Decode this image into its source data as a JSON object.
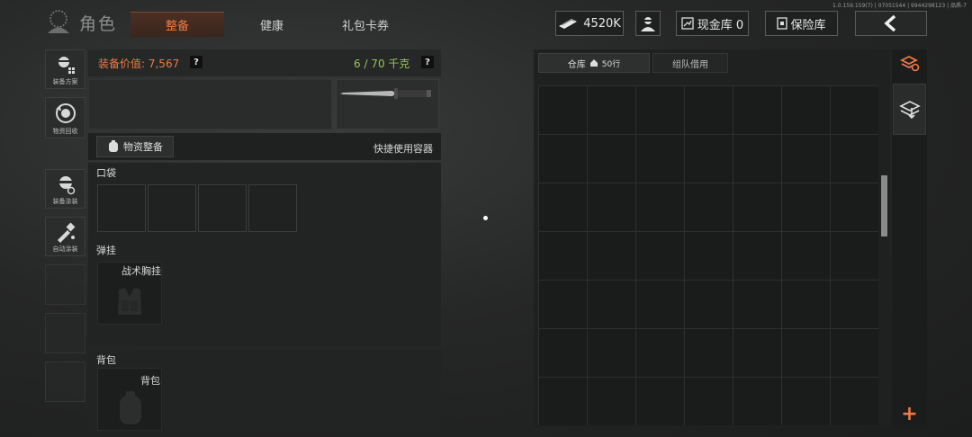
{
  "version": "1.0.159.159(7) | 07051544 | 9944298123 | 品质-7",
  "header": {
    "title": "角色",
    "tabs": [
      {
        "label": "整备",
        "active": true
      },
      {
        "label": "健康",
        "active": false
      },
      {
        "label": "礼包卡券",
        "active": false
      }
    ],
    "money": "4520K",
    "cashbox": "现金库 0",
    "safebox": "保险库"
  },
  "left_menu": [
    {
      "label": "装备方案",
      "icon": "loadout-plan-icon"
    },
    {
      "label": "物资回收",
      "icon": "recycle-icon"
    },
    {
      "label": "装备涂装",
      "icon": "gear-paint-icon"
    },
    {
      "label": "自动涂装",
      "icon": "auto-paint-icon"
    }
  ],
  "loadout": {
    "value_label": "装备价值: 7,567",
    "weight_label": "6 / 70 千克",
    "help": "?",
    "supply_button": "物资整备",
    "quick_container": "快捷使用容器",
    "pocket_title": "口袋",
    "rig_title": "弹挂",
    "rig_slot": "战术胸挂",
    "backpack_title": "背包",
    "backpack_slot": "背包"
  },
  "warehouse": {
    "tab_storage": "仓库",
    "tab_storage_rows": "50行",
    "tab_team": "组队借用",
    "add": "+"
  },
  "colors": {
    "accent": "#ee7a45",
    "weight_green": "#96c554"
  }
}
